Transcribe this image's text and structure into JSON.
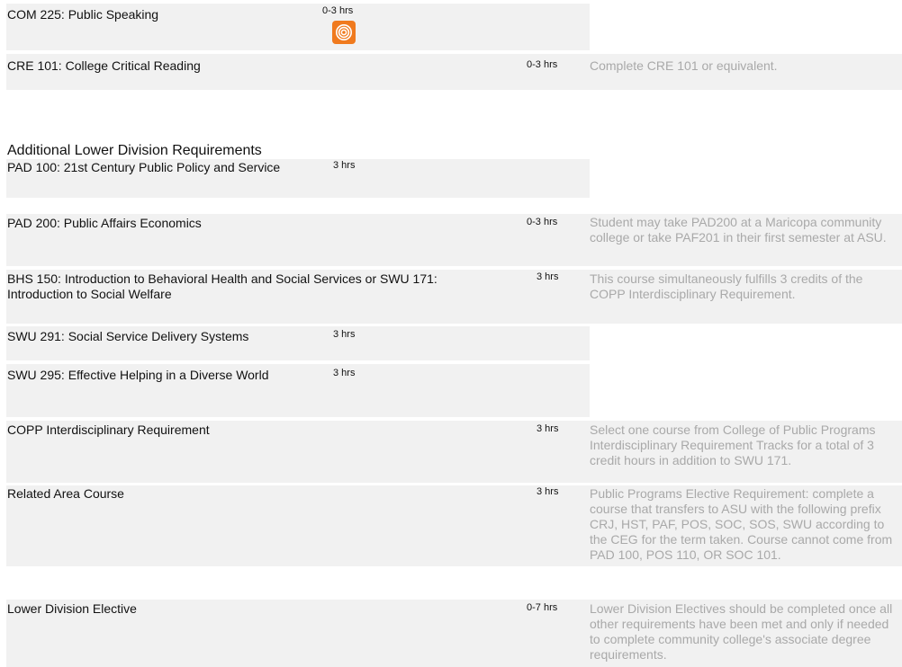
{
  "colors": {
    "row_bg": "#f1f1f1",
    "note_text": "#a9a9a9",
    "icon_accent": "#f07a1e"
  },
  "rows_top": [
    {
      "name": "COM 225: Public Speaking",
      "hours": "0-3 hrs",
      "note": "",
      "icon": "orange-target-icon"
    },
    {
      "name": "CRE 101: College Critical Reading",
      "hours": "0-3 hrs",
      "note": "Complete CRE 101 or equivalent."
    }
  ],
  "section": {
    "title": "Additional Lower Division Requirements"
  },
  "rows": [
    {
      "name": "PAD 100: 21st Century Public Policy and Service",
      "hours": "3 hrs",
      "note": ""
    },
    {
      "name": "PAD 200: Public Affairs Economics",
      "hours": "0-3 hrs",
      "note": "Student may take PAD200 at a Maricopa community college or take PAF201 in their first semester at ASU."
    },
    {
      "name": "BHS 150: Introduction to Behavioral Health and Social Services or SWU 171: Introduction to Social Welfare",
      "hours": "3 hrs",
      "note": "This course simultaneously fulfills 3 credits of the COPP Interdisciplinary Requirement."
    },
    {
      "name": "SWU 291: Social Service Delivery Systems",
      "hours": "3 hrs",
      "note": ""
    },
    {
      "name": "SWU 295: Effective Helping in a Diverse World",
      "hours": "3 hrs",
      "note": ""
    },
    {
      "name": "COPP Interdisciplinary Requirement",
      "hours": "3 hrs",
      "note": "Select one course from College of Public Programs Interdisciplinary Requirement Tracks for a total of 3 credit hours in addition to SWU 171."
    },
    {
      "name": "Related Area Course",
      "hours": "3 hrs",
      "note": "Public Programs Elective Requirement: complete a course that transfers to ASU with the following prefix CRJ, HST, PAF, POS, SOC, SOS, SWU according to the CEG for the term taken. Course cannot come from PAD 100, POS 110, OR SOC 101."
    },
    {
      "name": "Lower Division Elective",
      "hours": "0-7 hrs",
      "note": "Lower Division Electives should be completed once all other requirements have been met and only if needed to complete community college's associate degree requirements."
    }
  ]
}
